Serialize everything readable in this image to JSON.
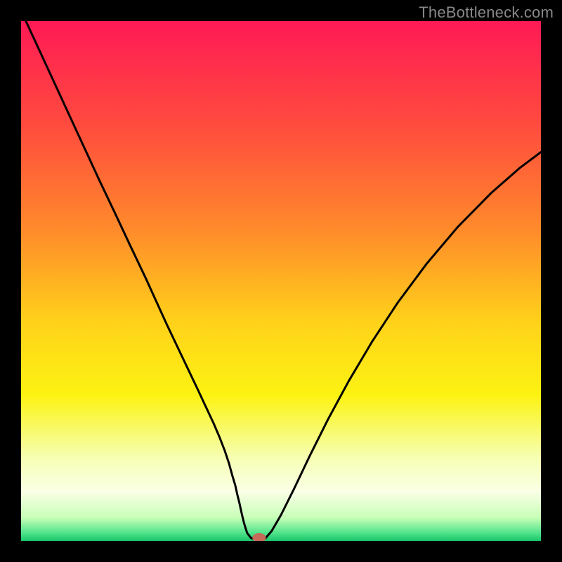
{
  "watermark": "TheBottleneck.com",
  "chart_data": {
    "type": "line",
    "title": "",
    "xlabel": "",
    "ylabel": "",
    "xlim": [
      0,
      100
    ],
    "ylim": [
      0,
      100
    ],
    "background": {
      "type": "vertical-gradient",
      "stops": [
        {
          "pos": 0.0,
          "color": "#ff1a55"
        },
        {
          "pos": 0.2,
          "color": "#ff4b3e"
        },
        {
          "pos": 0.4,
          "color": "#ff8a2b"
        },
        {
          "pos": 0.58,
          "color": "#ffd21a"
        },
        {
          "pos": 0.72,
          "color": "#fcf312"
        },
        {
          "pos": 0.84,
          "color": "#f6ffb3"
        },
        {
          "pos": 0.905,
          "color": "#faffe6"
        },
        {
          "pos": 0.955,
          "color": "#c8ffb8"
        },
        {
          "pos": 0.985,
          "color": "#4fe38a"
        },
        {
          "pos": 1.0,
          "color": "#19c56a"
        }
      ]
    },
    "series": [
      {
        "name": "bottleneck-curve",
        "color": "#000000",
        "x": [
          0,
          3,
          6,
          9,
          12,
          15,
          18,
          21,
          24,
          26,
          28,
          30,
          32,
          34,
          35.5,
          37,
          38.2,
          39.2,
          40.0,
          40.6,
          41.2,
          41.6,
          42.0,
          42.3,
          42.6,
          42.9,
          43.2,
          43.5,
          44.2,
          45.3,
          46.4,
          47.0,
          48.2,
          50.0,
          52.5,
          55.5,
          59.0,
          63.0,
          67.5,
          72.5,
          78.0,
          84.0,
          90.5,
          96.0,
          100.0
        ],
        "y": [
          102,
          95.5,
          89.0,
          82.5,
          76.0,
          69.5,
          63.2,
          56.8,
          50.5,
          46.1,
          41.7,
          37.5,
          33.3,
          29.1,
          25.9,
          22.7,
          19.9,
          17.3,
          14.9,
          12.7,
          10.7,
          8.9,
          7.3,
          5.9,
          4.6,
          3.4,
          2.4,
          1.5,
          0.6,
          0.15,
          0.15,
          0.5,
          1.9,
          5.0,
          10.0,
          16.3,
          23.3,
          30.7,
          38.3,
          45.9,
          53.3,
          60.4,
          67.0,
          71.8,
          74.8
        ]
      }
    ],
    "marker": {
      "name": "optimal-point",
      "x": 45.8,
      "y": 0.6,
      "rx": 1.3,
      "ry": 0.9,
      "color": "#c66a5a"
    }
  }
}
